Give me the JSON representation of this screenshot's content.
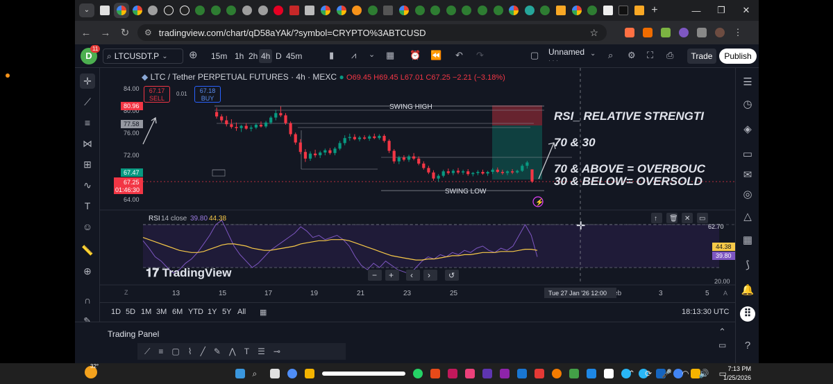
{
  "browser": {
    "url": "tradingview.com/chart/qD58aYAk/?symbol=CRYPTO%3ABTCUSD"
  },
  "toolbar": {
    "avatar_letter": "D",
    "notifications": "11",
    "symbol": "LTCUSDT.P",
    "intervals": [
      "15m",
      "1h",
      "2h",
      "4h",
      "D",
      "45m"
    ],
    "selected_interval": "4h",
    "layout_name": "Unnamed",
    "trade_label": "Trade",
    "publish_label": "Publish"
  },
  "legend": {
    "title": "LTC / Tether PERPETUAL FUTURES · 4h · MEXC",
    "ohlc": "O69.45 H69.45 L67.01 C67.25 −2.21 (−3.18%)"
  },
  "order": {
    "sell_price": "67.17",
    "sell_label": "SELL",
    "spread": "0.01",
    "buy_price": "67.18",
    "buy_label": "BUY"
  },
  "chart_data": {
    "type": "candlestick",
    "price_axis_ticks": [
      "84.00",
      "80.00",
      "76.00",
      "72.00",
      "64.00"
    ],
    "price_labels": {
      "high_marker": "80.96",
      "level_marker": "77.58",
      "bid_marker": "67.47",
      "last_price": "67.25",
      "countdown": "01:46:30"
    },
    "annotations": [
      "SWING HIGH",
      "SWING LOW"
    ],
    "time_axis_ticks": [
      "13",
      "15",
      "17",
      "19",
      "21",
      "23",
      "25",
      "Feb",
      "3",
      "5"
    ],
    "crosshair_time": "Tue 27 Jan '26   12:00",
    "candles": [
      {
        "o": 79.8,
        "h": 80.6,
        "l": 78.6,
        "c": 79.0
      },
      {
        "o": 79.0,
        "h": 79.4,
        "l": 77.9,
        "c": 78.3
      },
      {
        "o": 78.3,
        "h": 79.1,
        "l": 77.2,
        "c": 77.6
      },
      {
        "o": 77.6,
        "h": 78.5,
        "l": 76.8,
        "c": 77.1
      },
      {
        "o": 77.1,
        "h": 77.9,
        "l": 76.4,
        "c": 76.9
      },
      {
        "o": 76.9,
        "h": 77.5,
        "l": 76.2,
        "c": 77.3
      },
      {
        "o": 77.3,
        "h": 77.8,
        "l": 76.6,
        "c": 76.8
      },
      {
        "o": 76.8,
        "h": 77.4,
        "l": 76.3,
        "c": 77.0
      },
      {
        "o": 77.0,
        "h": 77.8,
        "l": 76.7,
        "c": 77.5
      },
      {
        "o": 77.5,
        "h": 78.1,
        "l": 77.0,
        "c": 77.2
      },
      {
        "o": 77.2,
        "h": 78.2,
        "l": 76.9,
        "c": 77.9
      },
      {
        "o": 77.9,
        "h": 79.1,
        "l": 77.6,
        "c": 78.8
      },
      {
        "o": 78.8,
        "h": 80.2,
        "l": 78.3,
        "c": 79.6
      },
      {
        "o": 79.6,
        "h": 80.8,
        "l": 78.9,
        "c": 79.2
      },
      {
        "o": 79.2,
        "h": 79.6,
        "l": 77.5,
        "c": 77.8
      },
      {
        "o": 77.8,
        "h": 78.1,
        "l": 75.4,
        "c": 75.8
      },
      {
        "o": 75.8,
        "h": 76.1,
        "l": 73.9,
        "c": 74.3
      },
      {
        "o": 74.3,
        "h": 74.9,
        "l": 72.2,
        "c": 72.6
      },
      {
        "o": 72.6,
        "h": 73.1,
        "l": 70.8,
        "c": 71.4
      },
      {
        "o": 71.4,
        "h": 72.7,
        "l": 71.0,
        "c": 72.3
      },
      {
        "o": 72.3,
        "h": 73.0,
        "l": 71.6,
        "c": 72.0
      },
      {
        "o": 72.0,
        "h": 72.8,
        "l": 71.5,
        "c": 72.5
      },
      {
        "o": 72.5,
        "h": 73.2,
        "l": 72.0,
        "c": 72.9
      },
      {
        "o": 72.9,
        "h": 73.3,
        "l": 72.1,
        "c": 72.4
      },
      {
        "o": 72.4,
        "h": 73.5,
        "l": 72.0,
        "c": 73.2
      },
      {
        "o": 73.2,
        "h": 74.6,
        "l": 72.9,
        "c": 74.2
      },
      {
        "o": 74.2,
        "h": 75.6,
        "l": 73.8,
        "c": 75.1
      },
      {
        "o": 75.1,
        "h": 75.9,
        "l": 74.6,
        "c": 75.3
      },
      {
        "o": 75.3,
        "h": 75.8,
        "l": 74.7,
        "c": 74.9
      },
      {
        "o": 74.9,
        "h": 75.5,
        "l": 74.5,
        "c": 75.2
      },
      {
        "o": 75.2,
        "h": 75.6,
        "l": 74.8,
        "c": 75.0
      },
      {
        "o": 75.0,
        "h": 75.7,
        "l": 74.6,
        "c": 75.4
      },
      {
        "o": 75.4,
        "h": 75.9,
        "l": 74.9,
        "c": 75.1
      },
      {
        "o": 75.1,
        "h": 75.8,
        "l": 74.8,
        "c": 75.5
      },
      {
        "o": 75.5,
        "h": 75.8,
        "l": 74.3,
        "c": 74.6
      },
      {
        "o": 74.6,
        "h": 74.9,
        "l": 72.4,
        "c": 72.8
      },
      {
        "o": 72.8,
        "h": 73.1,
        "l": 70.5,
        "c": 70.9
      },
      {
        "o": 70.9,
        "h": 71.9,
        "l": 70.4,
        "c": 71.6
      },
      {
        "o": 71.6,
        "h": 72.0,
        "l": 70.9,
        "c": 71.2
      },
      {
        "o": 71.2,
        "h": 72.1,
        "l": 70.8,
        "c": 71.8
      },
      {
        "o": 71.8,
        "h": 72.4,
        "l": 71.1,
        "c": 71.4
      },
      {
        "o": 71.4,
        "h": 71.8,
        "l": 70.2,
        "c": 70.5
      },
      {
        "o": 70.5,
        "h": 70.9,
        "l": 69.4,
        "c": 69.7
      },
      {
        "o": 69.7,
        "h": 70.1,
        "l": 68.6,
        "c": 68.9
      },
      {
        "o": 68.9,
        "h": 69.3,
        "l": 67.4,
        "c": 67.8
      },
      {
        "o": 67.8,
        "h": 68.6,
        "l": 67.2,
        "c": 68.3
      },
      {
        "o": 68.3,
        "h": 69.4,
        "l": 68.0,
        "c": 69.1
      },
      {
        "o": 69.1,
        "h": 69.6,
        "l": 68.5,
        "c": 68.8
      },
      {
        "o": 68.8,
        "h": 69.5,
        "l": 68.4,
        "c": 69.2
      },
      {
        "o": 69.2,
        "h": 69.7,
        "l": 68.6,
        "c": 68.9
      },
      {
        "o": 68.9,
        "h": 69.4,
        "l": 68.5,
        "c": 69.1
      },
      {
        "o": 69.1,
        "h": 69.5,
        "l": 68.3,
        "c": 68.6
      },
      {
        "o": 68.6,
        "h": 69.0,
        "l": 68.2,
        "c": 68.8
      },
      {
        "o": 68.8,
        "h": 69.3,
        "l": 68.4,
        "c": 69.0
      },
      {
        "o": 69.0,
        "h": 69.4,
        "l": 68.5,
        "c": 68.7
      },
      {
        "o": 68.7,
        "h": 69.2,
        "l": 68.3,
        "c": 69.0
      },
      {
        "o": 69.0,
        "h": 69.7,
        "l": 68.6,
        "c": 69.4
      },
      {
        "o": 69.4,
        "h": 69.8,
        "l": 68.8,
        "c": 69.0
      },
      {
        "o": 69.0,
        "h": 69.4,
        "l": 68.5,
        "c": 68.8
      },
      {
        "o": 68.8,
        "h": 69.3,
        "l": 68.4,
        "c": 69.1
      },
      {
        "o": 69.1,
        "h": 69.5,
        "l": 68.6,
        "c": 68.9
      },
      {
        "o": 68.9,
        "h": 69.4,
        "l": 68.7,
        "c": 69.2
      },
      {
        "o": 69.2,
        "h": 70.4,
        "l": 69.0,
        "c": 70.1
      },
      {
        "o": 70.1,
        "h": 71.0,
        "l": 69.6,
        "c": 70.7
      },
      {
        "o": 69.45,
        "h": 69.45,
        "l": 67.01,
        "c": 67.25
      }
    ],
    "rsi": {
      "label": "RSI",
      "params": "14 close",
      "value": "39.80",
      "ma_value": "44.38",
      "axis_ticks": [
        "62.70",
        "20.00"
      ],
      "line": [
        55,
        48,
        40,
        36,
        30,
        25,
        28,
        34,
        38,
        44,
        52,
        60,
        70,
        74,
        62,
        50,
        42,
        36,
        30,
        34,
        40,
        46,
        50,
        54,
        58,
        62,
        68,
        64,
        58,
        60,
        56,
        58,
        60,
        56,
        50,
        40,
        32,
        28,
        34,
        30,
        36,
        32,
        28,
        26,
        24,
        30,
        36,
        40,
        38,
        42,
        40,
        44,
        42,
        46,
        44,
        48,
        50,
        46,
        44,
        48,
        46,
        50,
        60,
        70,
        60,
        40
      ],
      "ma": [
        58,
        56,
        54,
        52,
        50,
        48,
        46,
        45,
        44,
        44,
        45,
        47,
        49,
        51,
        52,
        52,
        51,
        50,
        48,
        47,
        46,
        46,
        47,
        48,
        49,
        50,
        52,
        53,
        54,
        55,
        55,
        56,
        56,
        56,
        55,
        53,
        51,
        49,
        47,
        45,
        43,
        41,
        40,
        39,
        38,
        37,
        37,
        38,
        38,
        39,
        40,
        41,
        41,
        42,
        42,
        43,
        44,
        44,
        44,
        45,
        45,
        45,
        46,
        47,
        47,
        46
      ]
    }
  },
  "notes": [
    "RSI_ RELATIVE STRENGTI",
    "70  &  30",
    "70 & ABOVE = OVERBOUC",
    "30 & BELOW= OVERSOLD"
  ],
  "watermark": "TradingView",
  "date_ranges": [
    "1D",
    "5D",
    "1M",
    "3M",
    "6M",
    "YTD",
    "1Y",
    "5Y",
    "All"
  ],
  "utc_time": "18:13:30 UTC",
  "trading_panel_title": "Trading Panel",
  "taskbar": {
    "temperature": "32°",
    "time": "7:13 PM",
    "date": "1/25/2026"
  }
}
